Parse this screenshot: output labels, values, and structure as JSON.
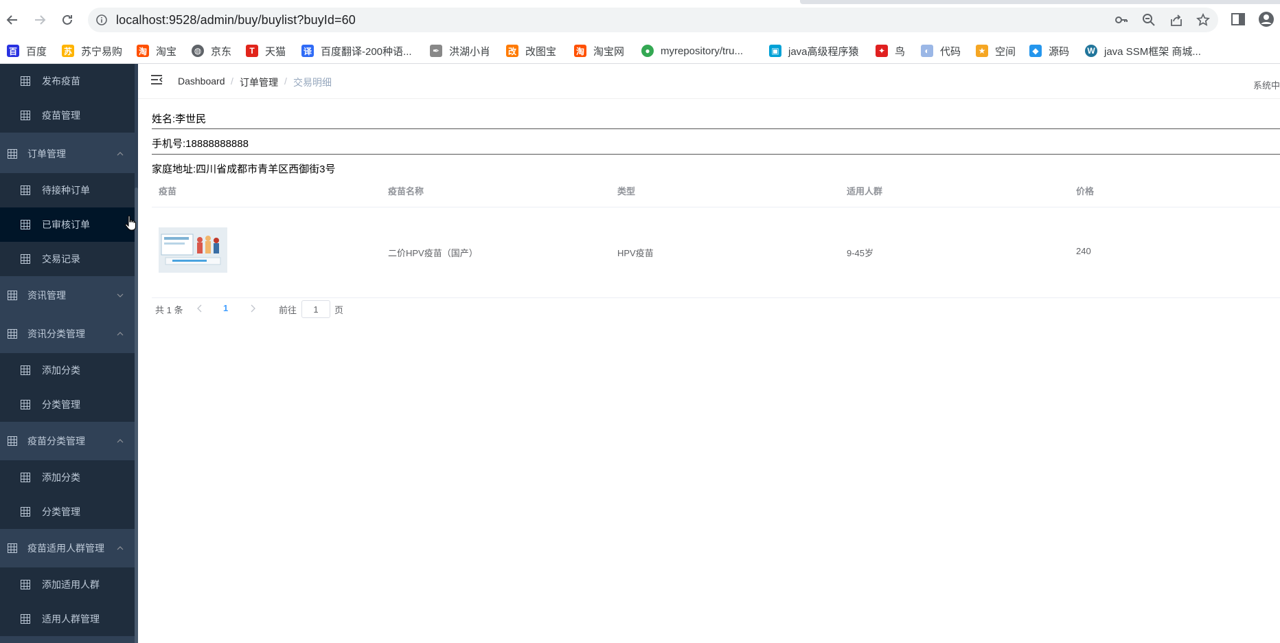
{
  "browser": {
    "url": "localhost:9528/admin/buy/buylist?buyId=60",
    "bookmarks": [
      {
        "label": "百度",
        "icon": "baidu-icon",
        "color": "#2932e1"
      },
      {
        "label": "苏宁易购",
        "icon": "suning-icon",
        "color": "#ffb400"
      },
      {
        "label": "淘宝",
        "icon": "taobao-icon",
        "color": "#ff5000"
      },
      {
        "label": "京东",
        "icon": "globe-icon",
        "color": "#5f6368"
      },
      {
        "label": "天猫",
        "icon": "tmall-icon",
        "color": "#e1251b"
      },
      {
        "label": "百度翻译-200种语...",
        "icon": "translate-icon",
        "color": "#2f6bf6"
      },
      {
        "label": "洪湖小肖",
        "icon": "feather-icon",
        "color": "#555555"
      },
      {
        "label": "改图宝",
        "icon": "gaitubao-icon",
        "color": "#ff7a00"
      },
      {
        "label": "淘宝网",
        "icon": "taobao-icon",
        "color": "#ff5000"
      },
      {
        "label": "myrepository/tru...",
        "icon": "chrome-icon",
        "color": "#34a853"
      },
      {
        "label": "java高级程序猿",
        "icon": "bilibili-icon",
        "color": "#00a1d6"
      },
      {
        "label": "鸟",
        "icon": "bird-icon",
        "color": "#e02020"
      },
      {
        "label": "代码",
        "icon": "code-icon",
        "color": "#9bb7e6"
      },
      {
        "label": "空间",
        "icon": "qzone-icon",
        "color": "#f5a623"
      },
      {
        "label": "源码",
        "icon": "docker-icon",
        "color": "#2496ed"
      },
      {
        "label": "java SSM框架 商城...",
        "icon": "wordpress-icon",
        "color": "#21759b"
      }
    ]
  },
  "sidebar": {
    "items": [
      {
        "label": "发布疫苗",
        "type": "sub"
      },
      {
        "label": "疫苗管理",
        "type": "sub"
      },
      {
        "label": "订单管理",
        "type": "group",
        "chevron": "up"
      },
      {
        "label": "待接种订单",
        "type": "sub"
      },
      {
        "label": "已审核订单",
        "type": "sub",
        "active": true
      },
      {
        "label": "交易记录",
        "type": "sub"
      },
      {
        "label": "资讯管理",
        "type": "group",
        "chevron": "down"
      },
      {
        "label": "资讯分类管理",
        "type": "group",
        "chevron": "up"
      },
      {
        "label": "添加分类",
        "type": "sub"
      },
      {
        "label": "分类管理",
        "type": "sub"
      },
      {
        "label": "疫苗分类管理",
        "type": "group",
        "chevron": "up"
      },
      {
        "label": "添加分类",
        "type": "sub"
      },
      {
        "label": "分类管理",
        "type": "sub"
      },
      {
        "label": "疫苗适用人群管理",
        "type": "group",
        "chevron": "up"
      },
      {
        "label": "添加适用人群",
        "type": "sub"
      },
      {
        "label": "适用人群管理",
        "type": "sub"
      }
    ]
  },
  "breadcrumb": [
    "Dashboard",
    "订单管理",
    "交易明细"
  ],
  "header": {
    "right_text": "系统中"
  },
  "customer": {
    "name": "姓名:李世民",
    "phone": "手机号:18888888888",
    "address": "家庭地址:四川省成都市青羊区西御街3号"
  },
  "table": {
    "columns": [
      "疫苗",
      "疫苗名称",
      "类型",
      "适用人群",
      "价格"
    ],
    "rows": [
      {
        "name": "二价HPV疫苗（国产）",
        "type": "HPV疫苗",
        "crowd": "9-45岁",
        "price": "240"
      }
    ]
  },
  "pagination": {
    "total": "共 1 条",
    "current": "1",
    "goto": "前往",
    "goto_value": "1",
    "page_suffix": "页"
  },
  "colors": {
    "sidebar_bg": "#304156",
    "sidebar_sub_bg": "#1f2d3d",
    "sidebar_active_bg": "#001528",
    "accent": "#409eff"
  }
}
